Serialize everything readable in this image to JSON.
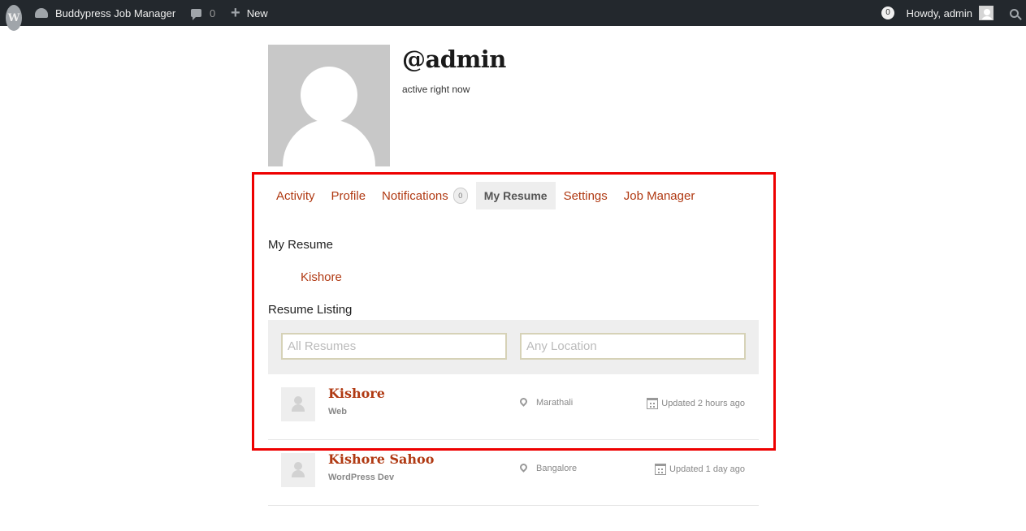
{
  "admin_bar": {
    "site_name": "Buddypress Job Manager",
    "comments_count": "0",
    "new_label": "New",
    "notification_count": "0",
    "howdy": "Howdy, admin"
  },
  "profile": {
    "username": "@admin",
    "status": "active right now"
  },
  "nav": {
    "items": [
      {
        "label": "Activity"
      },
      {
        "label": "Profile"
      },
      {
        "label": "Notifications",
        "count": "0"
      },
      {
        "label": "My Resume"
      },
      {
        "label": "Settings"
      },
      {
        "label": "Job Manager"
      }
    ],
    "current": "My Resume"
  },
  "my_resume": {
    "heading": "My Resume",
    "resume_link": "Kishore"
  },
  "resume_listing": {
    "heading": "Resume Listing",
    "keyword_placeholder": "All Resumes",
    "location_placeholder": "Any Location",
    "items": [
      {
        "name": "Kishore",
        "title": "Web",
        "location": "Marathali",
        "updated": "Updated 2 hours ago"
      },
      {
        "name": "Kishore Sahoo",
        "title": "WordPress Dev",
        "location": "Bangalore",
        "updated": "Updated 1 day ago"
      }
    ]
  },
  "colors": {
    "accent": "#b03912",
    "admin_bar": "#23282d",
    "highlight": "#ee0000"
  }
}
